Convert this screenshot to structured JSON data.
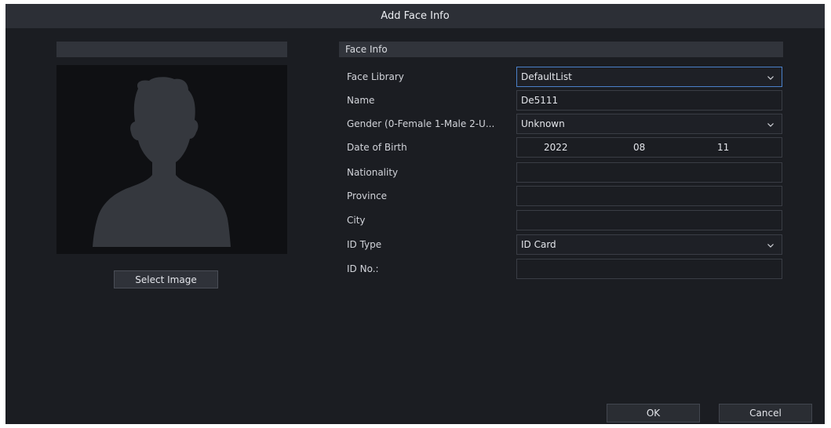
{
  "dialog": {
    "title": "Add Face Info"
  },
  "left_panel": {
    "select_image_label": "Select Image"
  },
  "form": {
    "section_title": "Face Info",
    "face_library": {
      "label": "Face Library",
      "value": "DefaultList"
    },
    "name": {
      "label": "Name",
      "value": "De5111"
    },
    "gender": {
      "label": "Gender (0-Female 1-Male 2-U...",
      "value": "Unknown"
    },
    "date_of_birth": {
      "label": "Date of Birth",
      "year": "2022",
      "month": "08",
      "day": "11"
    },
    "nationality": {
      "label": "Nationality",
      "value": ""
    },
    "province": {
      "label": "Province",
      "value": ""
    },
    "city": {
      "label": "City",
      "value": ""
    },
    "id_type": {
      "label": "ID Type",
      "value": "ID Card"
    },
    "id_no": {
      "label": "ID No.:",
      "value": ""
    }
  },
  "footer": {
    "ok_label": "OK",
    "cancel_label": "Cancel"
  },
  "icons": {
    "dropdown": "chevron-down-icon",
    "placeholder": "person-silhouette-icon"
  }
}
